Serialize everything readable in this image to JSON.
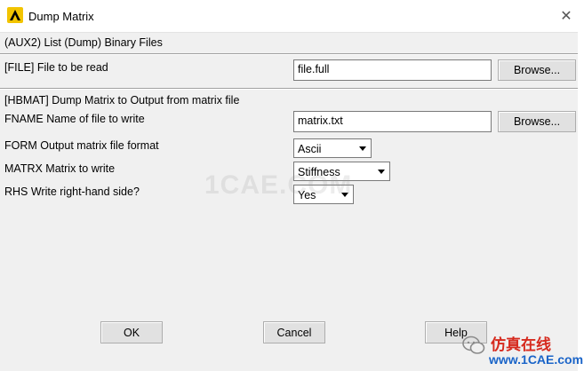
{
  "window": {
    "title": "Dump Matrix",
    "close_glyph": "✕",
    "app_icon": "ansys-logo-icon"
  },
  "header": {
    "command": "(AUX2)  List (Dump) Binary Files"
  },
  "file_section": {
    "label": "[FILE]  File to be read",
    "value": "file.full",
    "browse_label": "Browse..."
  },
  "hbmat_section": {
    "heading": "[HBMAT] Dump Matrix to Output from matrix file",
    "fname": {
      "label": "FNAME  Name of file to write",
      "value": "matrix.txt",
      "browse_label": "Browse..."
    },
    "form": {
      "label": "FORM   Output matrix file format",
      "value": "Ascii"
    },
    "matrx": {
      "label": "MATRX  Matrix to write",
      "value": "Stiffness"
    },
    "rhs": {
      "label": "RHS    Write right-hand side?",
      "value": "Yes"
    }
  },
  "buttons": {
    "ok": "OK",
    "cancel": "Cancel",
    "help": "Help"
  },
  "watermark": {
    "text": "1CAE.COM"
  },
  "brand": {
    "cn": "仿真在线",
    "en": "www.1CAE.com",
    "icon": "wechat-icon"
  },
  "colors": {
    "title_bg": "#ffffff",
    "dialog_bg": "#f0f0f0",
    "brand_red": "#d62a1e",
    "brand_blue": "#1a64c8"
  }
}
